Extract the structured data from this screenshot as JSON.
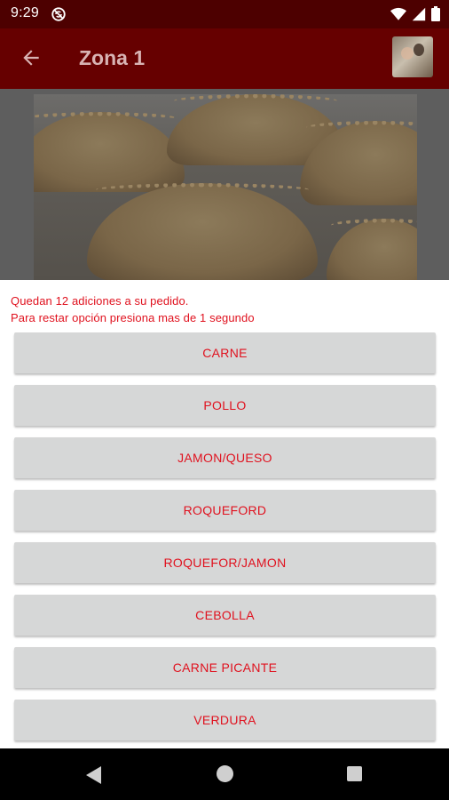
{
  "status_bar": {
    "time": "9:29",
    "icons": [
      "sync-off-icon",
      "wifi-icon",
      "cell-signal-icon",
      "battery-icon"
    ]
  },
  "app_bar": {
    "title": "Zona 1",
    "back_icon": "arrow-left-icon",
    "avatar": "user-avatar"
  },
  "hero": {
    "image": "empanadas-photo"
  },
  "dialog": {
    "message_line_1": "Quedan 12 adiciones a su pedido.",
    "message_line_2": "Para restar opción presiona mas de 1 segundo",
    "options": [
      "CARNE",
      "POLLO",
      "JAMON/QUESO",
      "ROQUEFORD",
      "ROQUEFOR/JAMON",
      "CEBOLLA",
      "CARNE PICANTE",
      "VERDURA"
    ]
  },
  "nav_bar": {
    "icons": [
      "nav-back-icon",
      "nav-home-icon",
      "nav-recents-icon"
    ]
  },
  "colors": {
    "status_bar": "#4d0000",
    "app_bar": "#660000",
    "accent_text": "#e0111e",
    "button_bg": "#d6d7d7"
  }
}
